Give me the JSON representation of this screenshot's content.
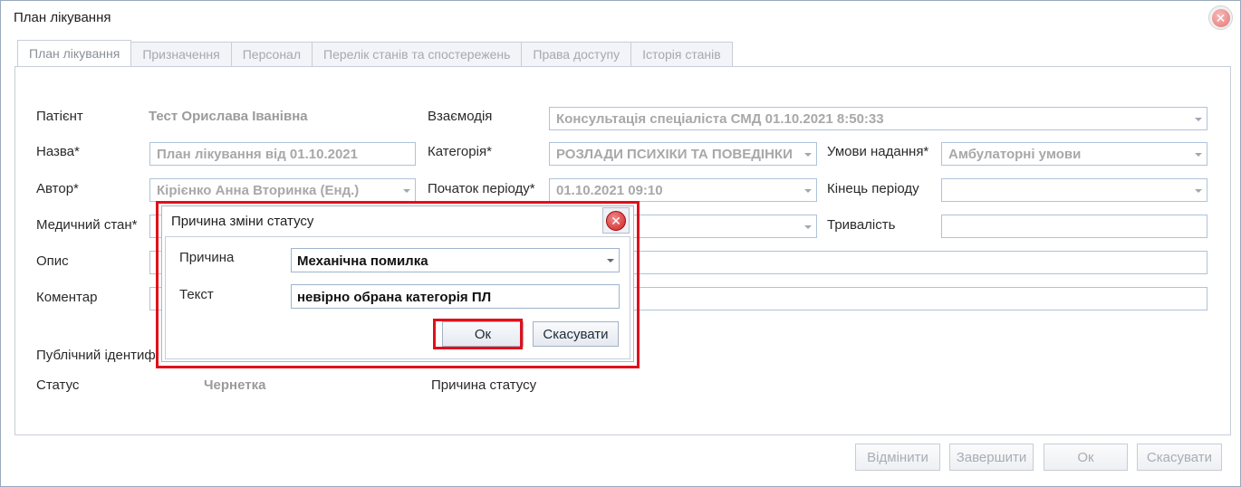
{
  "window": {
    "title": "План лікування"
  },
  "tabs": [
    {
      "label": "План лікування"
    },
    {
      "label": "Призначення"
    },
    {
      "label": "Персонал"
    },
    {
      "label": "Перелік станів та спостережень"
    },
    {
      "label": "Права доступу"
    },
    {
      "label": "Історія станів"
    }
  ],
  "form": {
    "patient_label": "Патієнт",
    "patient_value": "Тест Орислава Іванівна",
    "name_label": "Назва*",
    "name_value": "План лікування від 01.10.2021",
    "author_label": "Автор*",
    "author_value": "Кірієнко Анна Вторинка (Енд.)",
    "medical_state_label": "Медичний стан*",
    "description_label": "Опис",
    "comment_label": "Коментар",
    "public_id_label": "Публічний ідентифі",
    "status_label": "Статус",
    "status_value": "Чернетка",
    "status_reason_label": "Причина статусу",
    "interaction_label": "Взаємодія",
    "interaction_value": "Консультація спеціаліста СМД 01.10.2021 8:50:33",
    "category_label": "Категорія*",
    "category_value": "РОЗЛАДИ ПСИХІКИ ТА ПОВЕДІНКИ",
    "period_start_label": "Початок періоду*",
    "period_start_value": "01.10.2021 09:10",
    "conditions_label": "Умови надання*",
    "conditions_value": "Амбулаторні умови",
    "period_end_label": "Кінець періоду",
    "duration_label": "Тривалість"
  },
  "footer": {
    "cancel_record_label": "Відмінити",
    "complete_label": "Завершити",
    "ok_label": "Ок",
    "cancel_label": "Скасувати"
  },
  "dialog": {
    "title": "Причина зміни статусу",
    "reason_label": "Причина",
    "reason_value": "Механічна помилка",
    "text_label": "Текст",
    "text_value": "невірно обрана категорія ПЛ",
    "ok_label": "Ок",
    "cancel_label": "Скасувати"
  },
  "colors": {
    "highlight": "#e0101b",
    "field_border": "#aec3da"
  },
  "icons": {
    "window_close": "close-icon",
    "dialog_close": "close-icon",
    "dropdown": "chevron-down-icon"
  }
}
